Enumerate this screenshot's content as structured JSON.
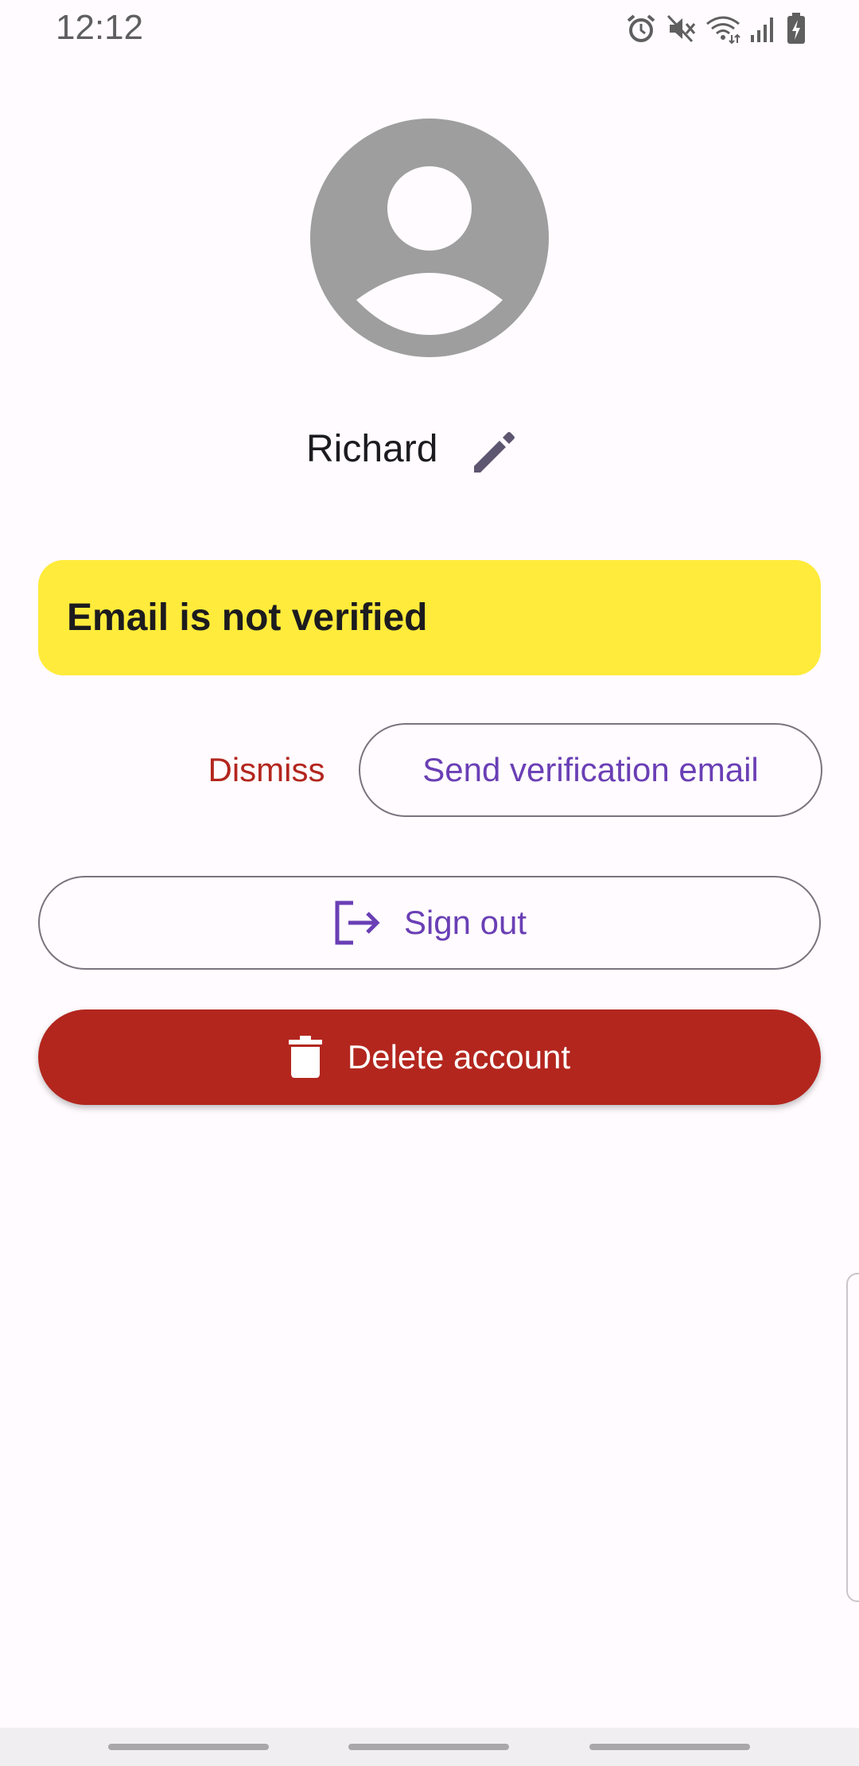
{
  "status_bar": {
    "time": "12:12",
    "icons": [
      "alarm-icon",
      "mute-icon",
      "wifi-icon",
      "signal-icon",
      "battery-charging-icon"
    ]
  },
  "profile": {
    "avatar_icon": "person-avatar-icon",
    "name": "Richard",
    "edit_icon": "pencil-icon"
  },
  "banner": {
    "message": "Email is not verified",
    "background_color": "#ffeb3b"
  },
  "actions": {
    "dismiss_label": "Dismiss",
    "send_verification_label": "Send verification email",
    "sign_out_label": "Sign out",
    "sign_out_icon": "logout-icon",
    "delete_account_label": "Delete account",
    "delete_icon": "trash-icon"
  },
  "colors": {
    "primary": "#6a3fb5",
    "error": "#b3261e",
    "outline": "#79747e",
    "background": "#fffbfe"
  }
}
